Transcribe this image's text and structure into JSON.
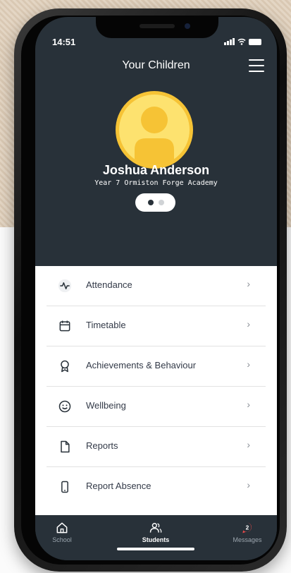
{
  "status_bar": {
    "time": "14:51"
  },
  "header": {
    "title": "Your Children"
  },
  "child": {
    "name": "Joshua Anderson",
    "subtitle": "Year 7 Ormiston Forge Academy"
  },
  "pager": {
    "count": 2,
    "active_index": 0
  },
  "menu": {
    "items": [
      {
        "label": "Attendance",
        "icon": "activity-icon"
      },
      {
        "label": "Timetable",
        "icon": "calendar-icon"
      },
      {
        "label": "Achievements & Behaviour",
        "icon": "award-icon"
      },
      {
        "label": "Wellbeing",
        "icon": "smile-icon"
      },
      {
        "label": "Reports",
        "icon": "file-icon"
      },
      {
        "label": "Report Absence",
        "icon": "phone-icon"
      }
    ],
    "chevron": "›"
  },
  "tabbar": {
    "tabs": [
      {
        "label": "School",
        "icon": "home-icon",
        "active": false
      },
      {
        "label": "Students",
        "icon": "users-icon",
        "active": true
      },
      {
        "label": "Messages",
        "icon": "message-icon",
        "active": false,
        "badge": "2"
      }
    ]
  },
  "colors": {
    "screen_bg": "#283139",
    "avatar_fill": "#fde26f",
    "avatar_ring": "#f6c335",
    "badge": "#e84a4a",
    "backdrop": "#e4d6c4"
  }
}
